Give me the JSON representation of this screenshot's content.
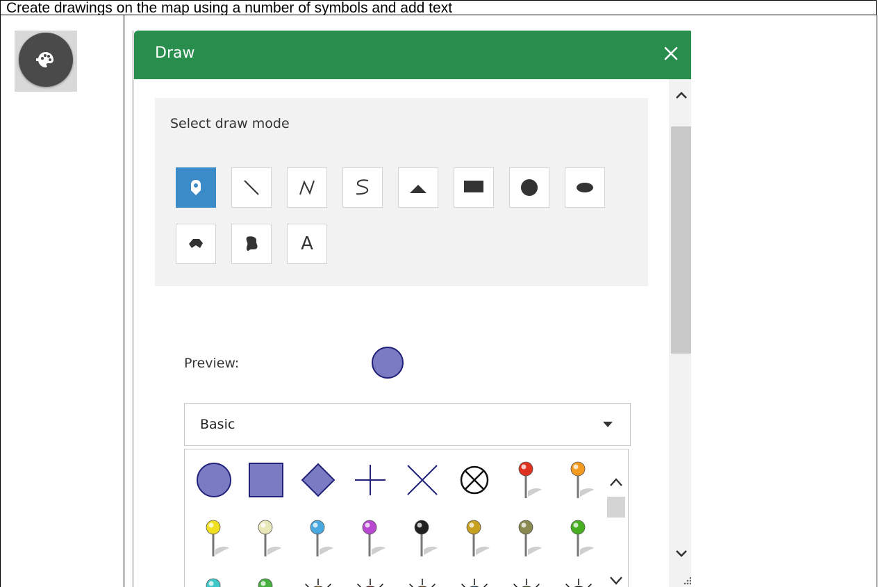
{
  "caption": "Create drawings on the map using a number of symbols and add text",
  "launch_icon": "draw-widget-icon",
  "panel": {
    "title": "Draw",
    "close_icon": "close-icon",
    "header_color": "#288d4d"
  },
  "mode": {
    "label": "Select draw mode",
    "buttons": [
      {
        "name": "point",
        "icon": "point-marker-icon",
        "active": true
      },
      {
        "name": "line",
        "icon": "line-icon"
      },
      {
        "name": "polyline",
        "icon": "polyline-icon"
      },
      {
        "name": "freehand-polyline",
        "icon": "freehand-line-icon"
      },
      {
        "name": "triangle",
        "icon": "triangle-icon"
      },
      {
        "name": "rectangle",
        "icon": "rectangle-icon"
      },
      {
        "name": "circle",
        "icon": "circle-icon"
      },
      {
        "name": "ellipse",
        "icon": "ellipse-icon"
      },
      {
        "name": "polygon",
        "icon": "polygon-icon"
      },
      {
        "name": "freehand-polygon",
        "icon": "freehand-polygon-icon"
      },
      {
        "name": "text",
        "icon": "text-icon",
        "glyph": "A"
      }
    ],
    "active_color": "#3a8bc8"
  },
  "preview": {
    "label": "Preview:",
    "fill": "#7b7bc4",
    "stroke": "#22227a"
  },
  "symbol_set": {
    "selected": "Basic"
  },
  "symbols": [
    {
      "type": "circle"
    },
    {
      "type": "square"
    },
    {
      "type": "diamond"
    },
    {
      "type": "cross"
    },
    {
      "type": "x"
    },
    {
      "type": "circled-x"
    },
    {
      "type": "pin",
      "color": "#e03020"
    },
    {
      "type": "pin",
      "color": "#f39a20"
    },
    {
      "type": "pin",
      "color": "#f0e020"
    },
    {
      "type": "pin",
      "color": "#e8e8b8"
    },
    {
      "type": "pin",
      "color": "#4aa8e0"
    },
    {
      "type": "pin",
      "color": "#b848d0"
    },
    {
      "type": "pin",
      "color": "#202020"
    },
    {
      "type": "pin",
      "color": "#c8a020"
    },
    {
      "type": "pin",
      "color": "#8a8a50"
    },
    {
      "type": "pin",
      "color": "#48b020"
    },
    {
      "type": "pin",
      "color": "#40c8c8"
    },
    {
      "type": "pin",
      "color": "#48b040"
    },
    {
      "type": "sun",
      "color": "#f8c020"
    },
    {
      "type": "sun",
      "color": "#d02020"
    },
    {
      "type": "sun",
      "color": "#f08020"
    },
    {
      "type": "sun",
      "color": "#3080d0"
    },
    {
      "type": "sun",
      "color": "#78a030"
    },
    {
      "type": "sun",
      "color": "#111111"
    }
  ]
}
